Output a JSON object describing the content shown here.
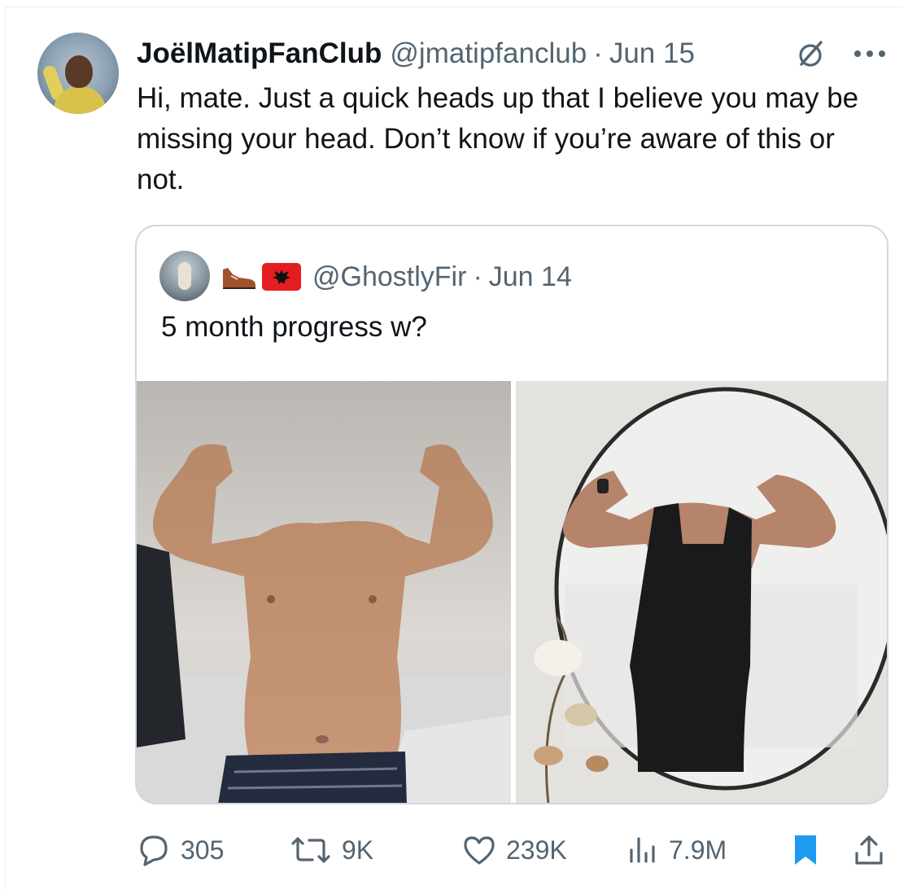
{
  "tweet": {
    "display_name": "JoëlMatipFanClub",
    "handle": "@jmatipfanclub",
    "separator": "·",
    "date": "Jun 15",
    "text": "Hi, mate. Just a quick heads up that I believe you may be missing your head. Don’t know if you’re aware of this or not."
  },
  "quote": {
    "handle": "@GhostlyFir",
    "separator": "·",
    "date": "Jun 14",
    "text": "5 month progress w?",
    "images": [
      "shirtless-flex-photo",
      "mirror-tank-top-flex-photo"
    ]
  },
  "actions": {
    "replies": "305",
    "reposts": "9K",
    "likes": "239K",
    "views": "7.9M"
  },
  "colors": {
    "text": "#0f1419",
    "secondary": "#536471",
    "bookmark": "#1d9bf0",
    "border": "#cfd9de"
  },
  "icons": [
    "grok-icon",
    "more-icon",
    "reply-icon",
    "repost-icon",
    "like-icon",
    "views-icon",
    "bookmark-icon",
    "share-icon",
    "shoe-emoji",
    "albania-flag-emoji"
  ]
}
